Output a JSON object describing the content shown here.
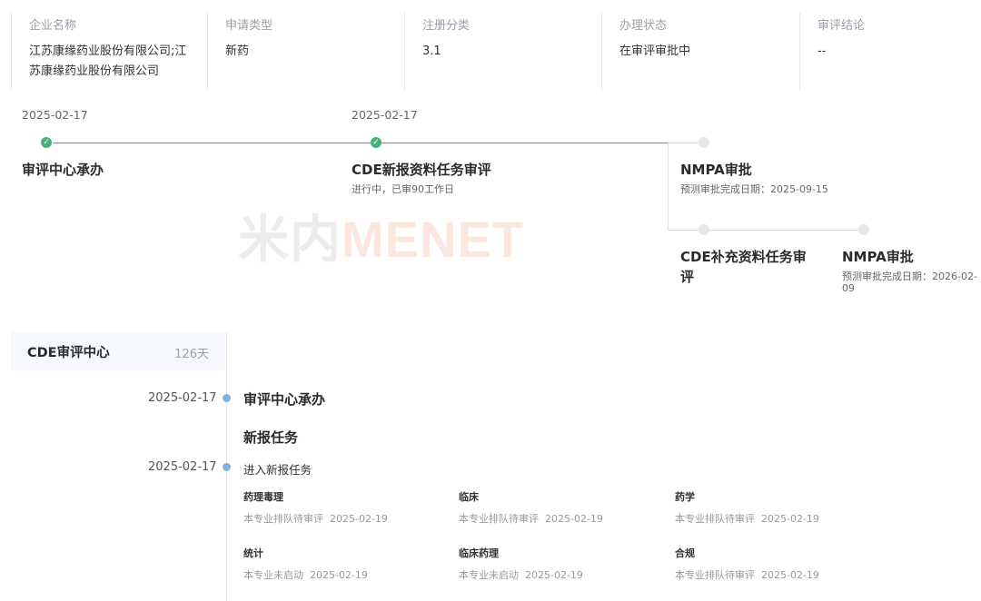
{
  "info": {
    "columns": [
      {
        "label": "企业名称",
        "value_lines": [
          "江苏康缘药业股份有限公司;江",
          "苏康缘药业股份有限公司"
        ]
      },
      {
        "label": "申请类型",
        "value_lines": [
          "新药"
        ]
      },
      {
        "label": "注册分类",
        "value_lines": [
          "3.1"
        ]
      },
      {
        "label": "办理状态",
        "value_lines": [
          "在审评审批中"
        ]
      },
      {
        "label": "审评结论",
        "value_lines": [
          "--"
        ]
      }
    ]
  },
  "flow": {
    "stages": [
      {
        "date": "2025-02-17",
        "title": "审评中心承办",
        "status": "done"
      },
      {
        "date": "2025-02-17",
        "title": "CDE新报资料任务审评",
        "subtitle": "进行中，已审90工作日",
        "status": "done"
      },
      {
        "title": "NMPA审批",
        "subtitle": "预测审批完成日期：2025-09-15",
        "status": "pending"
      },
      {
        "title_lines": [
          "CDE补充资料任务审",
          "评"
        ],
        "status": "pending"
      },
      {
        "title": "NMPA审批",
        "subtitle_lines": [
          "预测审批完成日期：2026-02-",
          "09"
        ],
        "status": "pending"
      }
    ],
    "check_glyph": "✓"
  },
  "watermark": {
    "part1": "米内",
    "part2": "MENET"
  },
  "timeline": {
    "center": "CDE审评中心",
    "days": "126天",
    "events": [
      {
        "date": "2025-02-17",
        "text": "审评中心承办"
      },
      {
        "heading": "新报任务"
      },
      {
        "date": "2025-02-17",
        "text": "进入新报任务"
      }
    ],
    "tasks": [
      {
        "name": "药理毒理",
        "status": "本专业排队待审评",
        "date": "2025-02-19"
      },
      {
        "name": "临床",
        "status": "本专业排队待审评",
        "date": "2025-02-19"
      },
      {
        "name": "药学",
        "status": "本专业排队待审评",
        "date": "2025-02-19"
      },
      {
        "name": "统计",
        "status": "本专业未启动",
        "date": "2025-02-19"
      },
      {
        "name": "临床药理",
        "status": "本专业未启动",
        "date": "2025-02-19"
      },
      {
        "name": "合规",
        "status": "本专业排队待审评",
        "date": "2025-02-19"
      }
    ]
  },
  "colors": {
    "done": "#45b378",
    "line": "#4cae7c",
    "pending": "#e3e6ea",
    "timeline_dot": "#7fb2dc"
  }
}
